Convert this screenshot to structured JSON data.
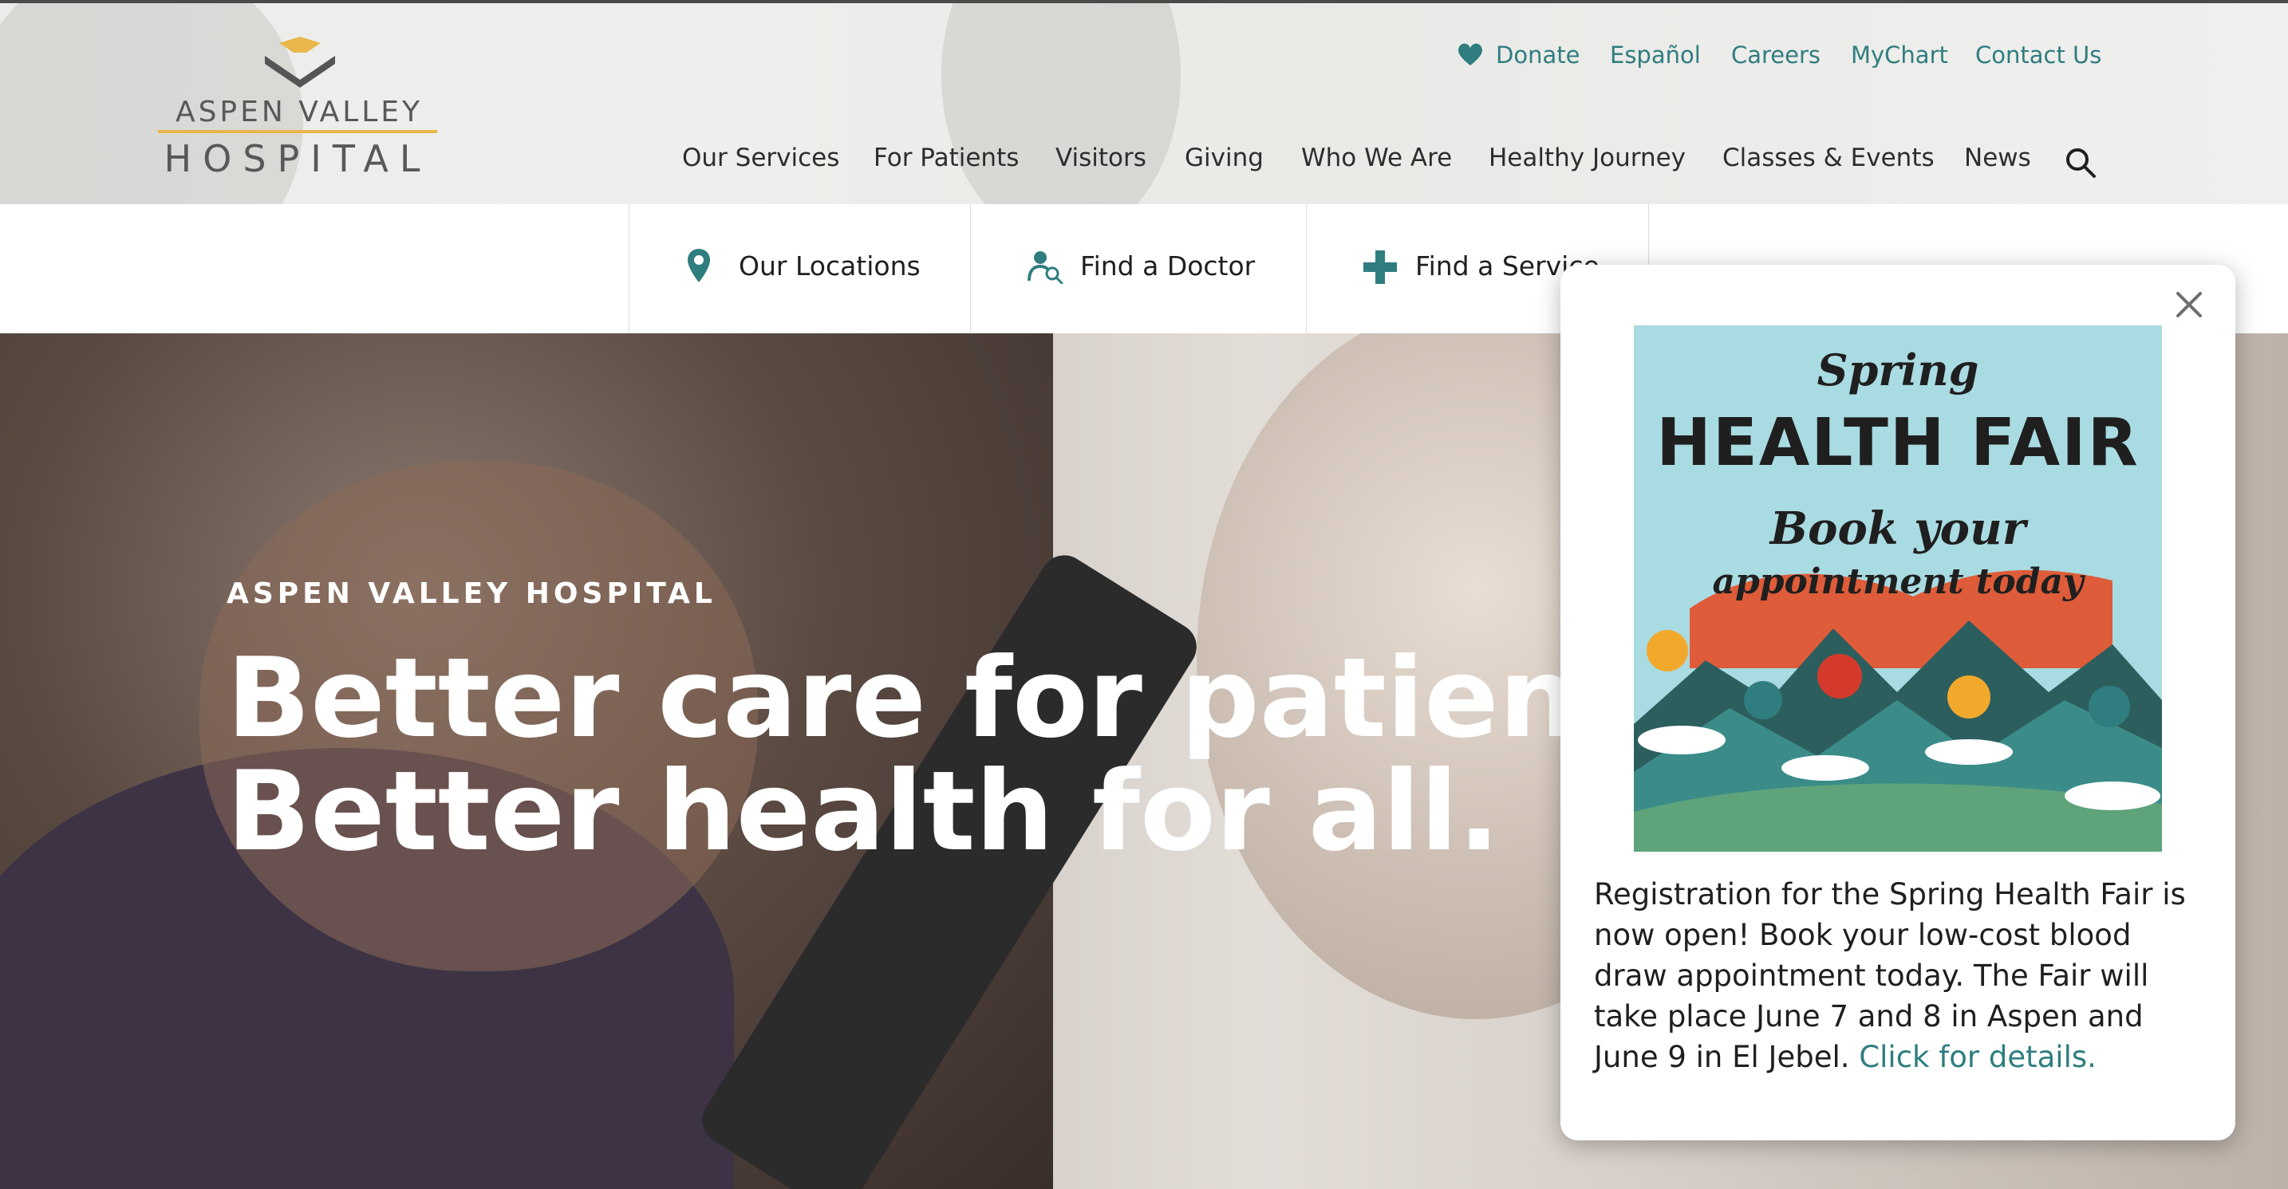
{
  "brand": {
    "line1": "ASPEN VALLEY",
    "line2": "HOSPITAL",
    "accent": "#e9b64b",
    "text_color": "#585858"
  },
  "utility_nav": {
    "donate": "Donate",
    "espanol": "Español",
    "careers": "Careers",
    "mychart": "MyChart",
    "contact": "Contact Us",
    "color": "#2f7d7f"
  },
  "main_nav": {
    "items": [
      "Our Services",
      "For Patients",
      "Visitors",
      "Giving",
      "Who We Are",
      "Healthy Journey",
      "Classes & Events",
      "News"
    ],
    "search_icon": "search-icon"
  },
  "quick_links": {
    "locations": "Our Locations",
    "doctor": "Find a Doctor",
    "service": "Find a Service",
    "icon_color": "#2f7d7f"
  },
  "hero": {
    "kicker": "ASPEN VALLEY HOSPITAL",
    "headline": "Better care for patients. Better health for all."
  },
  "popup": {
    "promo": {
      "script_title": "Spring",
      "title": "HEALTH FAIR",
      "banner_line1": "Book your",
      "banner_line2": "appointment today",
      "banner_color": "#e0552f",
      "background": "#a9dbe2"
    },
    "body": "Registration for the Spring Health Fair is now open! Book your low-cost blood draw appointment today. The Fair will take place June 7 and 8 in Aspen and June 9 in El Jebel.",
    "link": "Click for details."
  }
}
